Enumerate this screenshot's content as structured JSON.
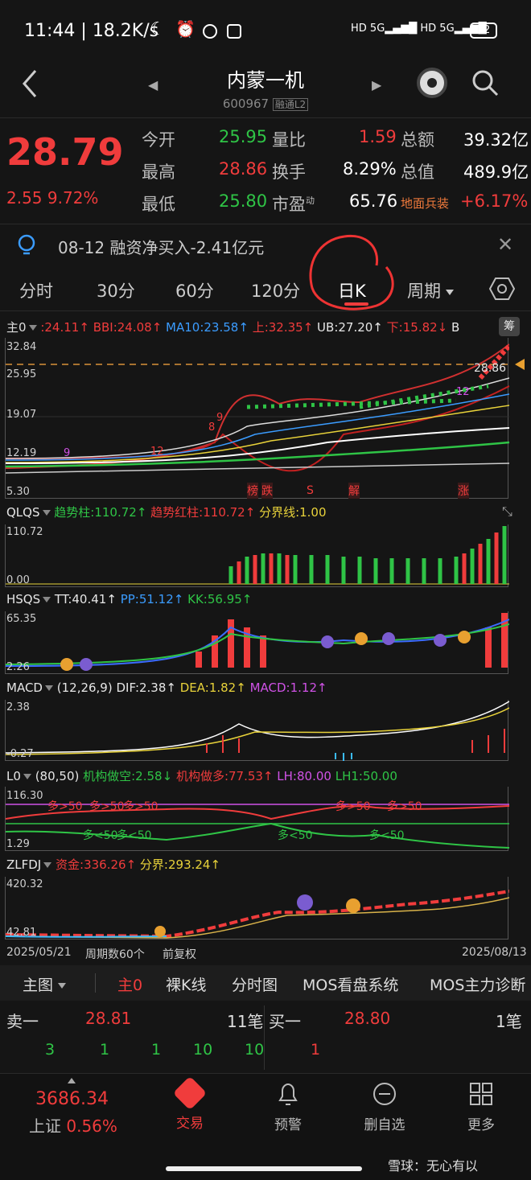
{
  "status": {
    "time": "11:44",
    "speed": "18.2K/s",
    "battery": "32"
  },
  "header": {
    "name": "内蒙一机",
    "code": "600967",
    "tags": "融通L2"
  },
  "quote": {
    "price": "28.79",
    "change": "2.55",
    "pct": "9.72%",
    "rows": [
      [
        {
          "k": "今开",
          "v": "25.95"
        },
        {
          "k": "量比",
          "v": "1.59"
        },
        {
          "k": "总额",
          "v": "39.32亿"
        }
      ],
      [
        {
          "k": "最高",
          "v": "28.86"
        },
        {
          "k": "换手",
          "v": "8.29%"
        },
        {
          "k": "总值",
          "v": "489.9亿"
        }
      ],
      [
        {
          "k": "最低",
          "v": "25.80"
        },
        {
          "k": "市盈",
          "v": "65.76",
          "sup": "动"
        },
        {
          "k": "地面兵装",
          "v": "+6.17%"
        }
      ]
    ]
  },
  "notice": {
    "text": "08-12 融资净买入-2.41亿元"
  },
  "tabs": [
    "分时",
    "30分",
    "60分",
    "120分",
    "日K",
    "周期"
  ],
  "main_legend": {
    "name": "主0",
    "items": [
      ":24.11↑",
      "BBI:24.08↑",
      "MA10:23.58↑",
      "上:32.35↑",
      "UB:27.20↑",
      "下:15.82↓",
      "B"
    ],
    "chip": "筹"
  },
  "main_axis": {
    "top": "32.84",
    "l2": "25.95",
    "l3": "19.07",
    "l4": "12.19",
    "bottom": "5.30",
    "last": "28.86"
  },
  "main_marks": [
    "8",
    "9",
    "12",
    "8",
    "9",
    "9",
    "12",
    "9",
    "榜",
    "跌",
    "S",
    "解",
    "涨"
  ],
  "qlqs": {
    "name": "QLQS",
    "a": "趋势柱:110.72↑",
    "b": "趋势红柱:110.72↑",
    "c": "分界线:1.00",
    "top": "110.72",
    "bottom": "0.00"
  },
  "hsqs": {
    "name": "HSQS",
    "tt": "TT:40.41↑",
    "pp": "PP:51.12↑",
    "kk": "KK:56.95↑",
    "top": "65.35",
    "bottom": "2.26"
  },
  "macd": {
    "name": "MACD",
    "p": "(12,26,9)",
    "dif": "DIF:2.38↑",
    "dea": "DEA:1.82↑",
    "macd": "MACD:1.12↑",
    "top": "2.38",
    "bottom": "-0.27"
  },
  "l0": {
    "name": "L0",
    "p": "(80,50)",
    "a": "机构做空:2.58↓",
    "b": "机构做多:77.53↑",
    "c": "LH:80.00",
    "d": "LH1:50.00",
    "top": "116.30",
    "bottom": "1.29",
    "labels": [
      "多>50",
      "多>50",
      "多>50",
      "多>50",
      "多>50",
      "多<50",
      "多<50",
      "多<50",
      "多<50"
    ]
  },
  "zlfdj": {
    "name": "ZLFDJ",
    "a": "资金:336.26↑",
    "b": "分界:293.24↑",
    "top": "420.32",
    "bottom": "42.81"
  },
  "footer_axis": {
    "start": "2025/05/21",
    "count": "周期数60个",
    "adj": "前复权",
    "end": "2025/08/13"
  },
  "indicator_bar": [
    "主图",
    "主0",
    "裸K线",
    "分时图",
    "MOS看盘系统",
    "MOS主力诊断"
  ],
  "order": {
    "sell_label": "卖一",
    "sell_price": "28.81",
    "sell_count": "11笔",
    "buy_label": "买一",
    "buy_price": "28.80",
    "buy_count": "1笔",
    "sell_detail": [
      "3",
      "1",
      "1",
      "10",
      "10"
    ],
    "buy_detail": [
      "1"
    ]
  },
  "bottom_nav": {
    "index_value": "3686.34",
    "index_name": "上证",
    "index_pct": "0.56%",
    "items": [
      "交易",
      "预警",
      "删自选",
      "更多"
    ]
  },
  "watermark": "雪球：无心有以"
}
